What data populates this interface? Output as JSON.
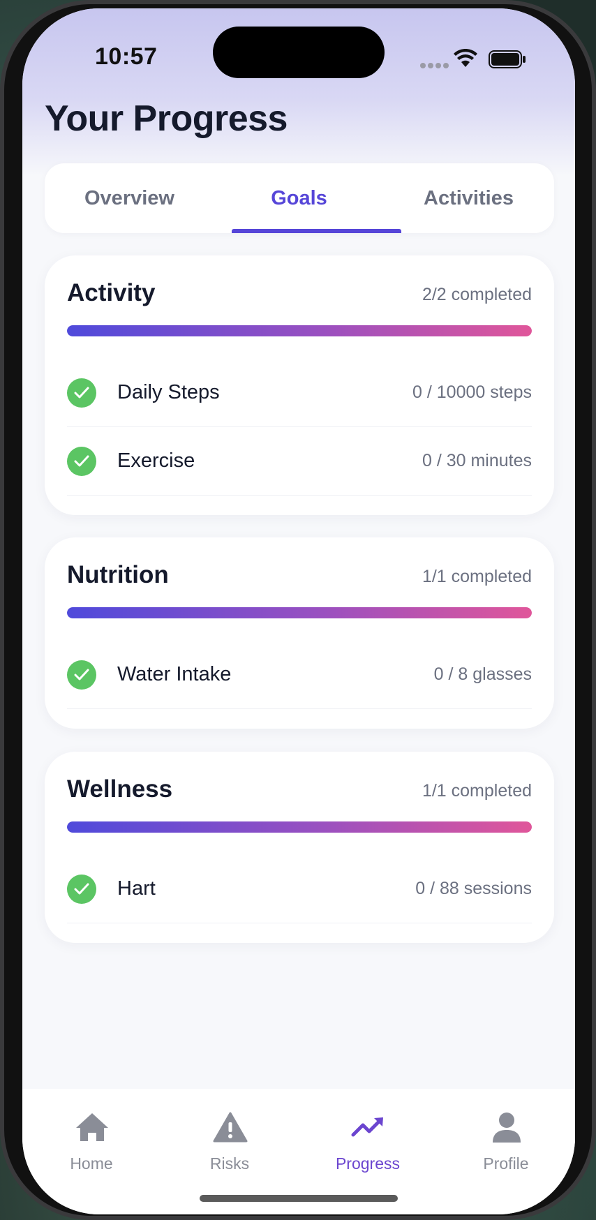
{
  "status_bar": {
    "time": "10:57"
  },
  "page": {
    "title": "Your Progress"
  },
  "tabs": [
    {
      "label": "Overview",
      "active": false
    },
    {
      "label": "Goals",
      "active": true
    },
    {
      "label": "Activities",
      "active": false
    }
  ],
  "categories": [
    {
      "title": "Activity",
      "count": "2/2 completed",
      "progress": 1.0,
      "goals": [
        {
          "name": "Daily Steps",
          "progress": "0 / 10000 steps",
          "icon": "check-circle-icon"
        },
        {
          "name": "Exercise",
          "progress": "0 / 30 minutes",
          "icon": "check-circle-icon"
        }
      ]
    },
    {
      "title": "Nutrition",
      "count": "1/1 completed",
      "progress": 1.0,
      "goals": [
        {
          "name": "Water Intake",
          "progress": "0 / 8 glasses",
          "icon": "check-circle-icon"
        }
      ]
    },
    {
      "title": "Wellness",
      "count": "1/1 completed",
      "progress": 1.0,
      "goals": [
        {
          "name": "Hart",
          "progress": "0 / 88 sessions",
          "icon": "check-circle-icon"
        }
      ]
    }
  ],
  "nav": [
    {
      "label": "Home",
      "icon": "home-icon",
      "active": false
    },
    {
      "label": "Risks",
      "icon": "warning-icon",
      "active": false
    },
    {
      "label": "Progress",
      "icon": "trending-up-icon",
      "active": true
    },
    {
      "label": "Profile",
      "icon": "user-icon",
      "active": false
    }
  ],
  "colors": {
    "accent": "#5646d8",
    "progress_start": "#4f4adb",
    "progress_end": "#e0569a",
    "success": "#5bc563",
    "nav_active": "#6b45cf"
  }
}
